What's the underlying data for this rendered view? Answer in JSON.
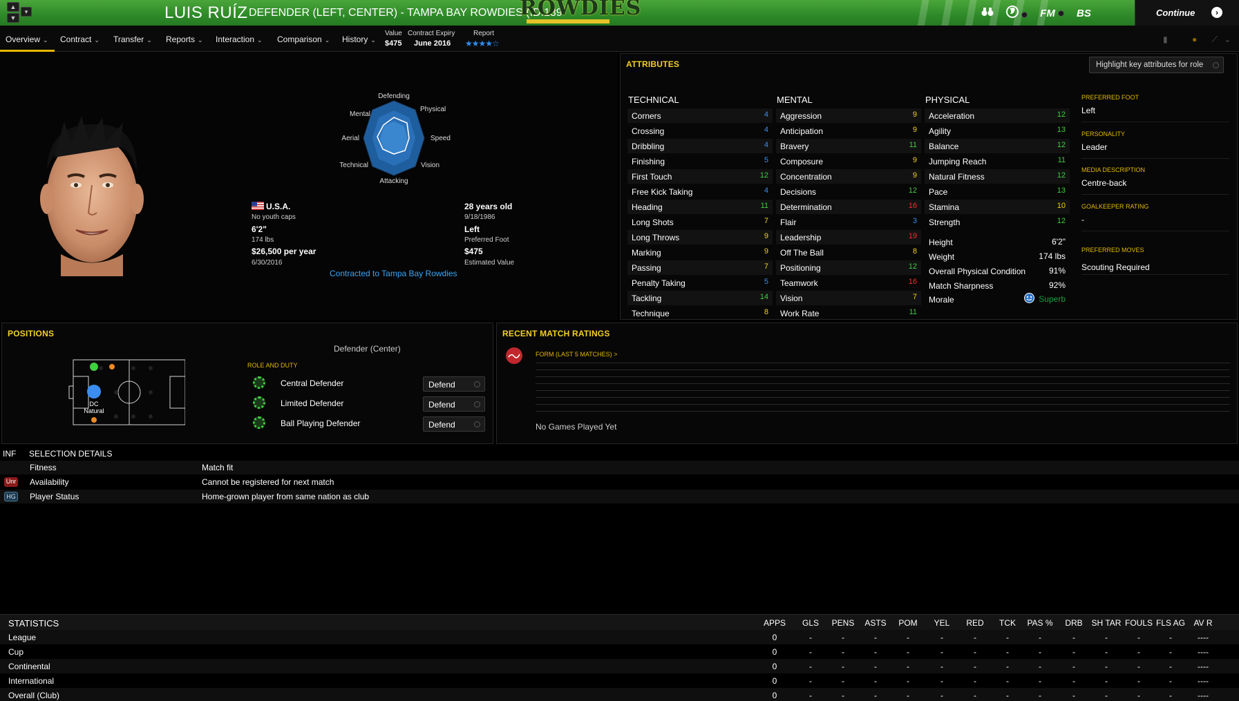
{
  "header": {
    "player_name": "LUIS RUÍZ",
    "subtitle": "DEFENDER (LEFT, CENTER) - TAMPA BAY ROWDIES (ID:139",
    "club_logo_text": "ROWDIES",
    "continue_label": "Continue",
    "icons": [
      "binoculars-icon",
      "globe-icon",
      "fm-icon",
      "bs-icon"
    ],
    "icon_text": {
      "fm": "FM",
      "bs": "BS"
    }
  },
  "menu": {
    "items": [
      "Overview",
      "Contract",
      "Transfer",
      "Reports",
      "Interaction",
      "Comparison",
      "History"
    ],
    "value_label": "Value",
    "value": "$475",
    "contract_expiry_label": "Contract Expiry",
    "contract_expiry": "June 2016",
    "report_label": "Report",
    "report_stars": 4
  },
  "overview": {
    "radar_labels": {
      "defending": "Defending",
      "physical": "Physical",
      "speed": "Speed",
      "vision": "Vision",
      "attacking": "Attacking",
      "technical": "Technical",
      "aerial": "Aerial",
      "mental": "Mental"
    },
    "nationality": "U.S.A.",
    "youth_caps": "No youth caps",
    "height": "6'2\"",
    "weight": "174 lbs",
    "wage": "$26,500 per year",
    "contract_end": "6/30/2016",
    "age": "28 years old",
    "dob": "9/18/1986",
    "foot": "Left",
    "foot_label": "Preferred Foot",
    "value": "$475",
    "value_label": "Estimated Value",
    "contracted_to": "Contracted to Tampa Bay Rowdies"
  },
  "attributes": {
    "title": "ATTRIBUTES",
    "highlight_label": "Highlight key attributes for role",
    "technical_header": "TECHNICAL",
    "mental_header": "MENTAL",
    "physical_header": "PHYSICAL",
    "technical": [
      {
        "name": "Corners",
        "value": 4
      },
      {
        "name": "Crossing",
        "value": 4
      },
      {
        "name": "Dribbling",
        "value": 4
      },
      {
        "name": "Finishing",
        "value": 5
      },
      {
        "name": "First Touch",
        "value": 12
      },
      {
        "name": "Free Kick Taking",
        "value": 4
      },
      {
        "name": "Heading",
        "value": 11
      },
      {
        "name": "Long Shots",
        "value": 7
      },
      {
        "name": "Long Throws",
        "value": 9
      },
      {
        "name": "Marking",
        "value": 9
      },
      {
        "name": "Passing",
        "value": 7
      },
      {
        "name": "Penalty Taking",
        "value": 5
      },
      {
        "name": "Tackling",
        "value": 14
      },
      {
        "name": "Technique",
        "value": 8
      }
    ],
    "mental": [
      {
        "name": "Aggression",
        "value": 9
      },
      {
        "name": "Anticipation",
        "value": 9
      },
      {
        "name": "Bravery",
        "value": 11
      },
      {
        "name": "Composure",
        "value": 9
      },
      {
        "name": "Concentration",
        "value": 9
      },
      {
        "name": "Decisions",
        "value": 12
      },
      {
        "name": "Determination",
        "value": 16
      },
      {
        "name": "Flair",
        "value": 3
      },
      {
        "name": "Leadership",
        "value": 19
      },
      {
        "name": "Off The Ball",
        "value": 8
      },
      {
        "name": "Positioning",
        "value": 12
      },
      {
        "name": "Teamwork",
        "value": 16
      },
      {
        "name": "Vision",
        "value": 7
      },
      {
        "name": "Work Rate",
        "value": 11
      }
    ],
    "physical": [
      {
        "name": "Acceleration",
        "value": 12
      },
      {
        "name": "Agility",
        "value": 13
      },
      {
        "name": "Balance",
        "value": 12
      },
      {
        "name": "Jumping Reach",
        "value": 11
      },
      {
        "name": "Natural Fitness",
        "value": 12
      },
      {
        "name": "Pace",
        "value": 13
      },
      {
        "name": "Stamina",
        "value": 10
      },
      {
        "name": "Strength",
        "value": 12
      }
    ],
    "physical_info": [
      {
        "name": "Height",
        "value": "6'2\""
      },
      {
        "name": "Weight",
        "value": "174 lbs"
      },
      {
        "name": "Overall Physical Condition",
        "value": "91%"
      },
      {
        "name": "Match Sharpness",
        "value": "92%"
      },
      {
        "name": "Morale",
        "value": "Superb"
      }
    ],
    "extras": [
      {
        "label": "PREFERRED FOOT",
        "value": "Left"
      },
      {
        "label": "PERSONALITY",
        "value": "Leader"
      },
      {
        "label": "MEDIA DESCRIPTION",
        "value": "Centre-back"
      },
      {
        "label": "GOALKEEPER RATING",
        "value": "-"
      },
      {
        "label": "PREFERRED MOVES",
        "value": "Scouting Required"
      }
    ]
  },
  "positions": {
    "title": "POSITIONS",
    "position_name": "Defender (Center)",
    "marker_label": "DC",
    "marker_sub": "Natural",
    "role_duty_label": "ROLE AND DUTY",
    "roles": [
      {
        "name": "Central Defender",
        "duty": "Defend"
      },
      {
        "name": "Limited Defender",
        "duty": "Defend"
      },
      {
        "name": "Ball Playing Defender",
        "duty": "Defend"
      }
    ]
  },
  "match_ratings": {
    "title": "RECENT MATCH RATINGS",
    "form_label": "FORM (LAST 5 MATCHES) >",
    "empty_text": "No Games Played Yet"
  },
  "selection": {
    "inf_header": "INF",
    "header": "SELECTION DETAILS",
    "rows": [
      {
        "badge": "",
        "label": "Fitness",
        "value": "Match fit"
      },
      {
        "badge": "Unr",
        "label": "Availability",
        "value": "Cannot be registered for next match"
      },
      {
        "badge": "HG",
        "label": "Player Status",
        "value": "Home-grown player from same nation as club"
      }
    ]
  },
  "statistics": {
    "header": "STATISTICS",
    "columns": [
      "APPS",
      "GLS",
      "PENS",
      "ASTS",
      "POM",
      "YEL",
      "RED",
      "TCK",
      "PAS %",
      "DRB",
      "SH TAR",
      "FOULS",
      "FLS AG",
      "AV R"
    ],
    "rows": [
      {
        "name": "League",
        "cells": [
          "0",
          "-",
          "-",
          "-",
          "-",
          "-",
          "-",
          "-",
          "-",
          "-",
          "-",
          "-",
          "-",
          "----"
        ]
      },
      {
        "name": "Cup",
        "cells": [
          "0",
          "-",
          "-",
          "-",
          "-",
          "-",
          "-",
          "-",
          "-",
          "-",
          "-",
          "-",
          "-",
          "----"
        ]
      },
      {
        "name": "Continental",
        "cells": [
          "0",
          "-",
          "-",
          "-",
          "-",
          "-",
          "-",
          "-",
          "-",
          "-",
          "-",
          "-",
          "-",
          "----"
        ]
      },
      {
        "name": "International",
        "cells": [
          "0",
          "-",
          "-",
          "-",
          "-",
          "-",
          "-",
          "-",
          "-",
          "-",
          "-",
          "-",
          "-",
          "----"
        ]
      },
      {
        "name": "Overall (Club)",
        "cells": [
          "0",
          "-",
          "-",
          "-",
          "-",
          "-",
          "-",
          "-",
          "-",
          "-",
          "-",
          "-",
          "-",
          "----"
        ]
      }
    ]
  },
  "colors": {
    "accent": "#e4b800",
    "header_green": "#2e8a28",
    "link_blue": "#3ba6f6",
    "attr_low": "#3b8ef0",
    "attr_mid": "#f2d21b",
    "attr_good": "#3fd03f",
    "attr_high": "#ff2a2a"
  }
}
